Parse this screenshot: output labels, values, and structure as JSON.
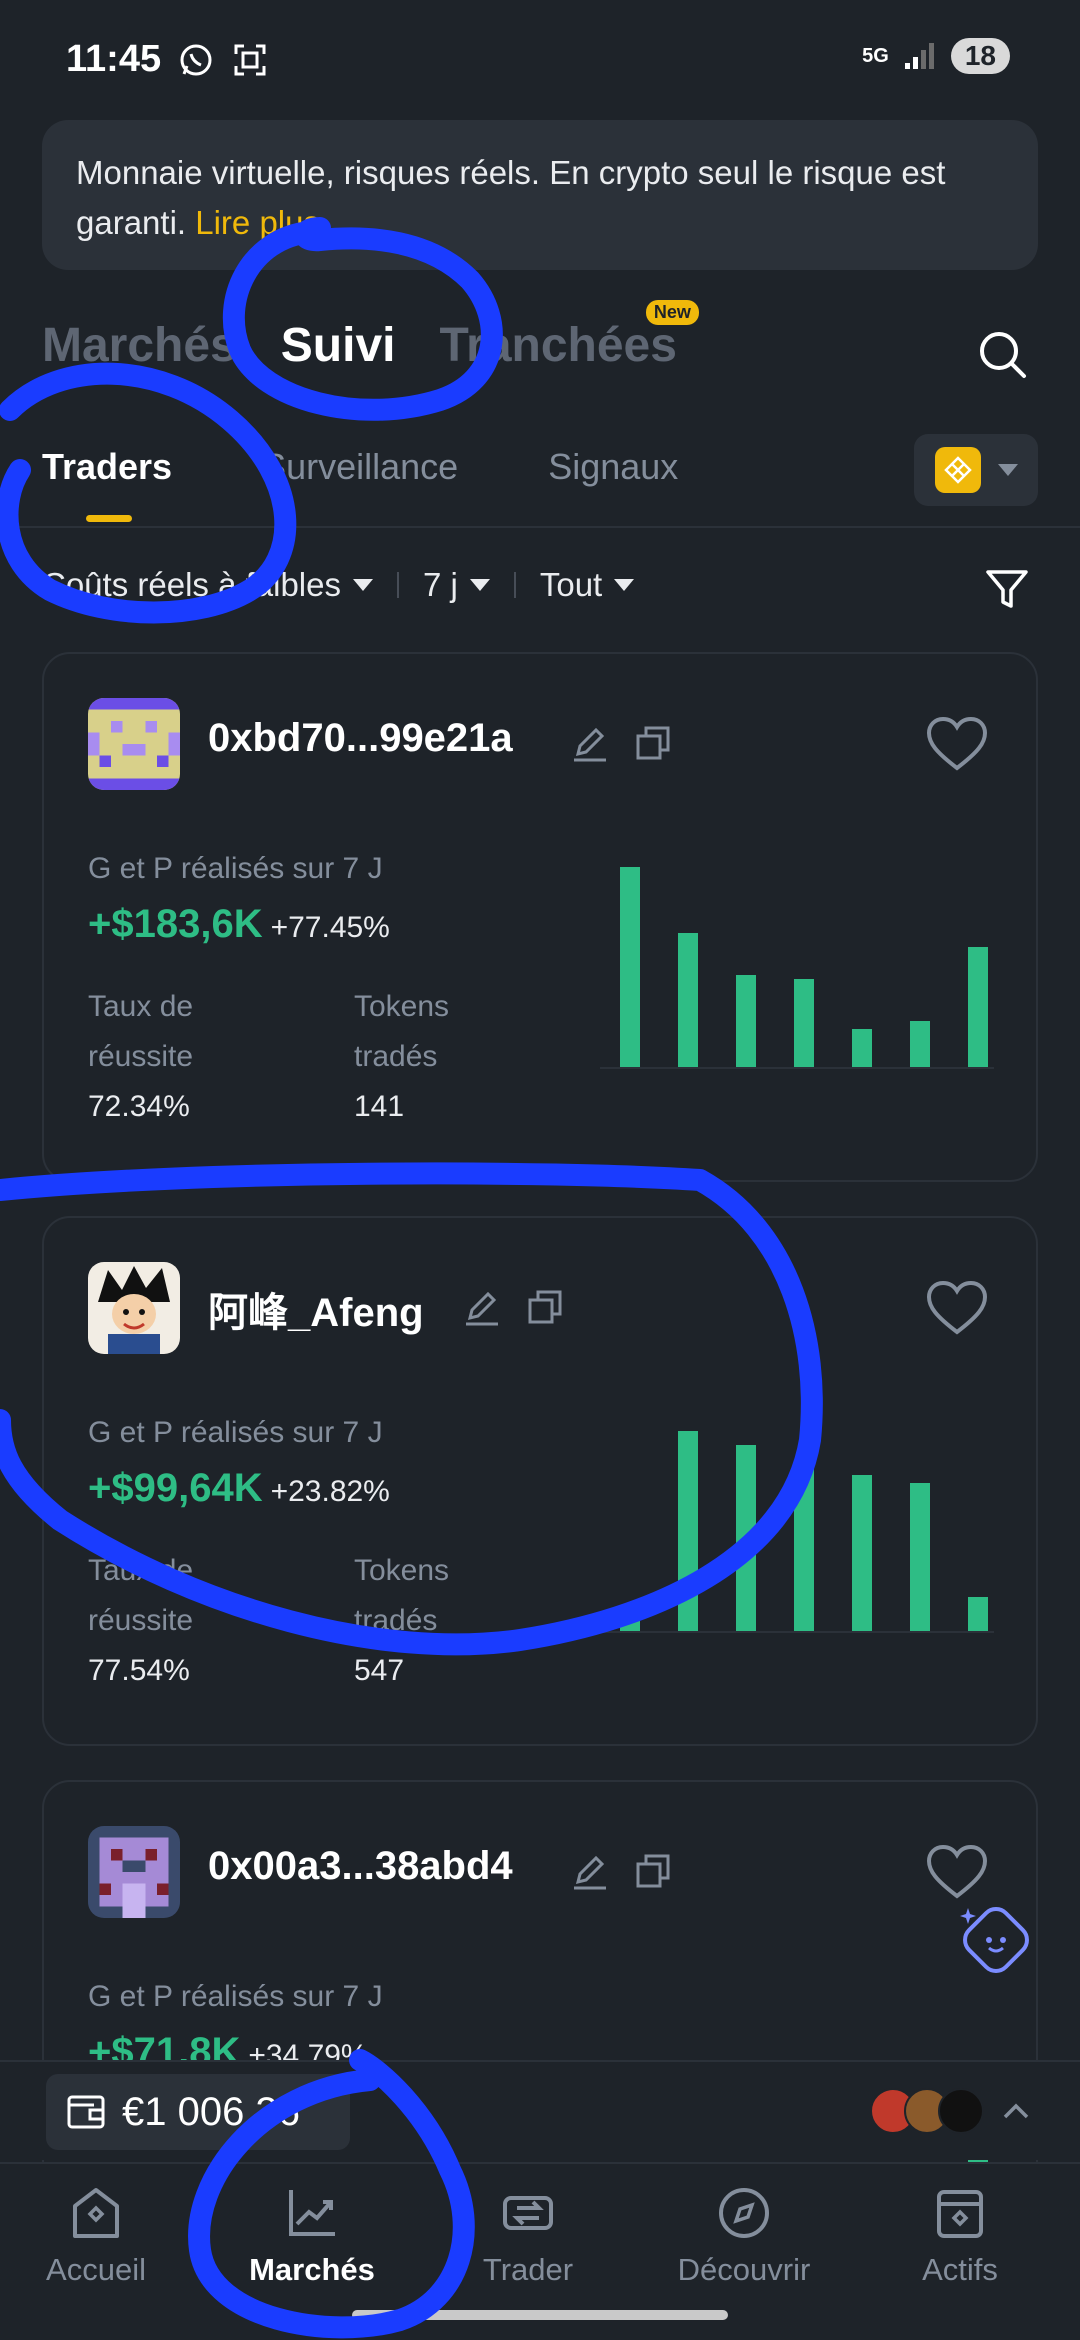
{
  "status_bar": {
    "time": "11:45",
    "network": "5G",
    "battery": "18"
  },
  "banner": {
    "text": "Monnaie virtuelle, risques réels. En crypto seul le risque est garanti.",
    "link": "Lire plus"
  },
  "main_tabs": [
    {
      "label": "Marchés",
      "active": false
    },
    {
      "label": "Suivi",
      "active": true
    },
    {
      "label": "Tranchées",
      "active": false,
      "badge": "New"
    }
  ],
  "sub_tabs": [
    {
      "label": "Traders",
      "active": true
    },
    {
      "label": "Surveillance",
      "active": false
    },
    {
      "label": "Signaux",
      "active": false
    }
  ],
  "filters": {
    "risk": "Coûts réels à faibles",
    "period": "7 j",
    "scope": "Tout"
  },
  "cards": [
    {
      "name": "0xbd70...99e21a",
      "pnl_label": "G et P réalisés sur 7 J",
      "pnl_value": "+$183,6K",
      "pnl_pct": "+77.45%",
      "win_rate_label_1": "Taux de",
      "win_rate_label_2": "réussite",
      "win_rate": "72.34%",
      "tokens_label_1": "Tokens",
      "tokens_label_2": "tradés",
      "tokens": "141",
      "bars": [
        1.0,
        0.67,
        0.46,
        0.44,
        0.19,
        0.23,
        0.6
      ]
    },
    {
      "name": "阿峰_Afeng",
      "pnl_label": "G et P réalisés sur 7 J",
      "pnl_value": "+$99,64K",
      "pnl_pct": "+23.82%",
      "win_rate_label_1": "Taux de",
      "win_rate_label_2": "réussite",
      "win_rate": "77.54%",
      "tokens_label_1": "Tokens",
      "tokens_label_2": "tradés",
      "tokens": "547",
      "bars": [
        0.07,
        1.0,
        0.93,
        0.81,
        0.78,
        0.74,
        0.17
      ]
    },
    {
      "name": "0x00a3...38abd4",
      "pnl_label": "G et P réalisés sur 7 J",
      "pnl_value": "+$71,8K",
      "pnl_pct": "+34.79%",
      "bars": [
        0,
        0,
        0,
        0,
        0,
        0,
        0.55
      ]
    }
  ],
  "wallet": {
    "balance": "€1 006,36"
  },
  "bottom_nav": [
    {
      "label": "Accueil",
      "icon": "home-icon",
      "active": false
    },
    {
      "label": "Marchés",
      "icon": "chart-icon",
      "active": true
    },
    {
      "label": "Trader",
      "icon": "swap-icon",
      "active": false
    },
    {
      "label": "Découvrir",
      "icon": "compass-icon",
      "active": false
    },
    {
      "label": "Actifs",
      "icon": "wallet-icon",
      "active": false
    }
  ],
  "colors": {
    "accent": "#f0b90b",
    "profit": "#2ebd85",
    "background": "#1e2329",
    "surface": "#2b3139",
    "annotation": "#1a3cff"
  }
}
